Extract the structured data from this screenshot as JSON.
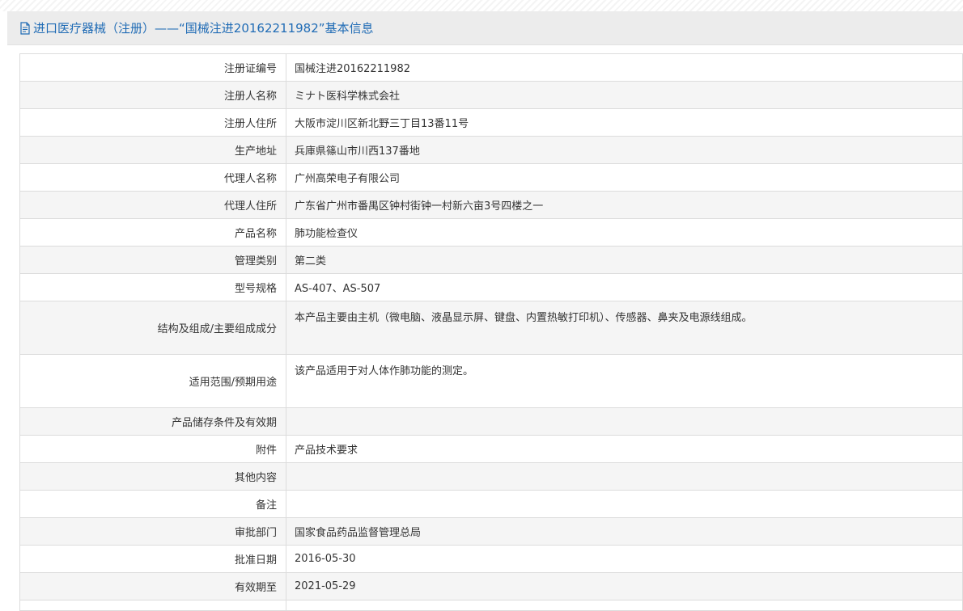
{
  "header": {
    "title": "进口医疗器械（注册）——“国械注进20162211982”基本信息",
    "icon": "document-icon",
    "color": "#1f6bb5"
  },
  "rows": [
    {
      "label": "注册证编号",
      "value": "国械注进20162211982"
    },
    {
      "label": "注册人名称",
      "value": "ミナト医科学株式会社"
    },
    {
      "label": "注册人住所",
      "value": "大阪市淀川区新北野三丁目13番11号"
    },
    {
      "label": "生产地址",
      "value": "兵庫県篠山市川西137番地"
    },
    {
      "label": "代理人名称",
      "value": "广州高荣电子有限公司"
    },
    {
      "label": "代理人住所",
      "value": "广东省广州市番禺区钟村街钟一村新六亩3号四楼之一"
    },
    {
      "label": "产品名称",
      "value": "肺功能检查仪"
    },
    {
      "label": "管理类别",
      "value": "第二类"
    },
    {
      "label": "型号规格",
      "value": "AS-407、AS-507"
    },
    {
      "label": "结构及组成/主要组成成分",
      "value": "本产品主要由主机（微电脑、液晶显示屏、键盘、内置热敏打印机）、传感器、鼻夹及电源线组成。"
    },
    {
      "label": "适用范围/预期用途",
      "value": "该产品适用于对人体作肺功能的测定。"
    },
    {
      "label": "产品储存条件及有效期",
      "value": ""
    },
    {
      "label": "附件",
      "value": "产品技术要求"
    },
    {
      "label": "其他内容",
      "value": ""
    },
    {
      "label": "备注",
      "value": ""
    },
    {
      "label": "审批部门",
      "value": "国家食品药品监督管理总局"
    },
    {
      "label": "批准日期",
      "value": "2016-05-30"
    },
    {
      "label": "有效期至",
      "value": "2021-05-29"
    }
  ]
}
